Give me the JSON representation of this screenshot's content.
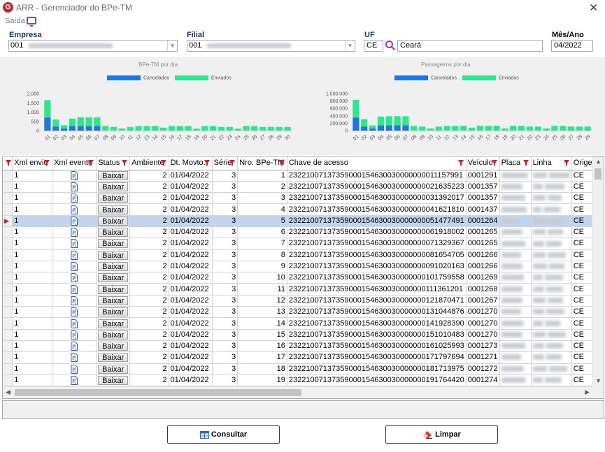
{
  "window": {
    "title": "ARR - Gerenciador do BPe-TM",
    "app_icon_letter": "G"
  },
  "menu": {
    "exit_label": "Saída"
  },
  "filters": {
    "empresa_label": "Empresa",
    "empresa_code": "001",
    "filial_label": "Filial",
    "filial_code": "001",
    "uf_label": "UF",
    "uf_value": "CE",
    "uf_name": "Ceará",
    "mes_ano_label": "Mês/Ano",
    "mes_ano_value": "04/2022"
  },
  "chart_data": [
    {
      "type": "bar",
      "title": "BPe-TM por dia",
      "categories": [
        "01",
        "02",
        "03",
        "04",
        "05",
        "06",
        "07",
        "08",
        "09",
        "10",
        "11",
        "12",
        "13",
        "14",
        "15",
        "16",
        "17",
        "18",
        "19",
        "20",
        "21",
        "22",
        "23",
        "24",
        "25",
        "26",
        "27",
        "28",
        "29",
        "30"
      ],
      "series": [
        {
          "name": "Cancelados",
          "values": [
            700,
            220,
            120,
            250,
            250,
            250,
            250,
            0,
            0,
            0,
            0,
            0,
            0,
            0,
            0,
            0,
            0,
            0,
            0,
            0,
            0,
            0,
            0,
            0,
            0,
            0,
            0,
            0,
            0,
            0
          ]
        },
        {
          "name": "Enviados",
          "values": [
            950,
            380,
            170,
            400,
            470,
            470,
            470,
            250,
            200,
            120,
            200,
            250,
            250,
            250,
            160,
            250,
            250,
            250,
            110,
            250,
            250,
            200,
            200,
            110,
            250,
            250,
            200,
            200,
            200,
            200
          ]
        }
      ],
      "yticks": [
        "0",
        "500",
        "1.000",
        "1.500",
        "2.000"
      ],
      "ylim": [
        0,
        2000
      ],
      "legend": "top-center",
      "colors": {
        "Cancelados": "#1a78e0",
        "Enviados": "#2de88a"
      }
    },
    {
      "type": "bar",
      "title": "Passageiros por dia",
      "categories": [
        "01",
        "02",
        "03",
        "04",
        "05",
        "06",
        "07",
        "08",
        "09",
        "10",
        "11",
        "12",
        "13",
        "14",
        "15",
        "16",
        "17",
        "18",
        "19",
        "20",
        "21",
        "22",
        "23",
        "24",
        "25",
        "26",
        "27",
        "28",
        "29",
        "30"
      ],
      "series": [
        {
          "name": "Cancelados",
          "values": [
            350000,
            110000,
            60000,
            140000,
            140000,
            140000,
            140000,
            0,
            0,
            0,
            0,
            0,
            0,
            0,
            0,
            0,
            0,
            0,
            0,
            0,
            0,
            0,
            0,
            0,
            0,
            0,
            0,
            0,
            0,
            0
          ]
        },
        {
          "name": "Enviados",
          "values": [
            480000,
            200000,
            80000,
            240000,
            250000,
            250000,
            250000,
            130000,
            110000,
            60000,
            110000,
            130000,
            130000,
            130000,
            80000,
            130000,
            130000,
            130000,
            60000,
            130000,
            130000,
            110000,
            110000,
            60000,
            130000,
            130000,
            110000,
            110000,
            110000,
            110000
          ]
        }
      ],
      "yticks": [
        "0",
        "200.000",
        "400.000",
        "600.000",
        "800.000",
        "1.000.000"
      ],
      "ylim": [
        0,
        1000000
      ],
      "legend": "top-center",
      "colors": {
        "Cancelados": "#1a78e0",
        "Enviados": "#2de88a"
      }
    }
  ],
  "grid": {
    "columns": [
      "Xml envio",
      "Xml evento",
      "Status",
      "Ambiente",
      "Dt. Movto.",
      "Série",
      "Nro. BPe-TM",
      "Chave de acesso",
      "Veículo",
      "Placa",
      "Linha",
      "Origem"
    ],
    "button_label": "Baixar",
    "rows": [
      {
        "xml_envio": "1",
        "ambiente": "2",
        "dt": "01/04/2022",
        "serie": "3",
        "nro": "1",
        "chave": "23221007137359000154630030000000011157991",
        "veiculo": "0001291",
        "origem": "CE"
      },
      {
        "xml_envio": "1",
        "ambiente": "2",
        "dt": "01/04/2022",
        "serie": "3",
        "nro": "2",
        "chave": "23221007137359000154630030000000021635223",
        "veiculo": "0001357",
        "origem": "CE"
      },
      {
        "xml_envio": "1",
        "ambiente": "2",
        "dt": "01/04/2022",
        "serie": "3",
        "nro": "3",
        "chave": "23221007137359000154630030000000031392017",
        "veiculo": "0001357",
        "origem": "CE"
      },
      {
        "xml_envio": "1",
        "ambiente": "2",
        "dt": "01/04/2022",
        "serie": "3",
        "nro": "4",
        "chave": "23221007137359000154630030000000041621810",
        "veiculo": "0001437",
        "origem": "CE"
      },
      {
        "xml_envio": "1",
        "ambiente": "2",
        "dt": "01/04/2022",
        "serie": "3",
        "nro": "5",
        "chave": "23221007137359000154630030000000051477491",
        "veiculo": "0001264",
        "origem": "CE"
      },
      {
        "xml_envio": "1",
        "ambiente": "2",
        "dt": "01/04/2022",
        "serie": "3",
        "nro": "6",
        "chave": "23221007137359000154630030000000061918002",
        "veiculo": "0001265",
        "origem": "CE"
      },
      {
        "xml_envio": "1",
        "ambiente": "2",
        "dt": "01/04/2022",
        "serie": "3",
        "nro": "7",
        "chave": "23221007137359000154630030000000071329367",
        "veiculo": "0001265",
        "origem": "CE"
      },
      {
        "xml_envio": "1",
        "ambiente": "2",
        "dt": "01/04/2022",
        "serie": "3",
        "nro": "8",
        "chave": "23221007137359000154630030000000081654705",
        "veiculo": "0001266",
        "origem": "CE"
      },
      {
        "xml_envio": "1",
        "ambiente": "2",
        "dt": "01/04/2022",
        "serie": "3",
        "nro": "9",
        "chave": "23221007137359000154630030000000091020163",
        "veiculo": "0001266",
        "origem": "CE"
      },
      {
        "xml_envio": "1",
        "ambiente": "2",
        "dt": "01/04/2022",
        "serie": "3",
        "nro": "10",
        "chave": "23221007137359000154630030000000101759558",
        "veiculo": "0001269",
        "origem": "CE"
      },
      {
        "xml_envio": "1",
        "ambiente": "2",
        "dt": "01/04/2022",
        "serie": "3",
        "nro": "11",
        "chave": "23221007137359000154630030000000111361201",
        "veiculo": "0001268",
        "origem": "CE"
      },
      {
        "xml_envio": "1",
        "ambiente": "2",
        "dt": "01/04/2022",
        "serie": "3",
        "nro": "12",
        "chave": "23221007137359000154630030000000121870471",
        "veiculo": "0001267",
        "origem": "CE"
      },
      {
        "xml_envio": "1",
        "ambiente": "2",
        "dt": "01/04/2022",
        "serie": "3",
        "nro": "13",
        "chave": "23221007137359000154630030000000131044876",
        "veiculo": "0001270",
        "origem": "CE"
      },
      {
        "xml_envio": "1",
        "ambiente": "2",
        "dt": "01/04/2022",
        "serie": "3",
        "nro": "14",
        "chave": "23221007137359000154630030000000141928390",
        "veiculo": "0001270",
        "origem": "CE"
      },
      {
        "xml_envio": "1",
        "ambiente": "2",
        "dt": "01/04/2022",
        "serie": "3",
        "nro": "15",
        "chave": "23221007137359000154630030000000151010483",
        "veiculo": "0001270",
        "origem": "CE"
      },
      {
        "xml_envio": "1",
        "ambiente": "2",
        "dt": "01/04/2022",
        "serie": "3",
        "nro": "16",
        "chave": "23221007137359000154630030000000161025993",
        "veiculo": "0001273",
        "origem": "CE"
      },
      {
        "xml_envio": "1",
        "ambiente": "2",
        "dt": "01/04/2022",
        "serie": "3",
        "nro": "17",
        "chave": "23221007137359000154630030000000171797694",
        "veiculo": "0001271",
        "origem": "CE"
      },
      {
        "xml_envio": "1",
        "ambiente": "2",
        "dt": "01/04/2022",
        "serie": "3",
        "nro": "18",
        "chave": "23221007137359000154630030000000181713975",
        "veiculo": "0001272",
        "origem": "CE"
      },
      {
        "xml_envio": "1",
        "ambiente": "2",
        "dt": "01/04/2022",
        "serie": "3",
        "nro": "19",
        "chave": "23221007137359000154630030000000191764420",
        "veiculo": "0001274",
        "origem": "CE"
      }
    ],
    "selected_row": 4
  },
  "actions": {
    "consultar_label": "Consultar",
    "limpar_label": "Limpar"
  },
  "icons": {
    "close": "close-icon",
    "exit": "monitor-exit-icon",
    "search": "search-icon",
    "xml": "xml-file-icon",
    "filter": "filter-icon",
    "consultar": "grid-table-icon",
    "limpar": "eraser-icon"
  }
}
